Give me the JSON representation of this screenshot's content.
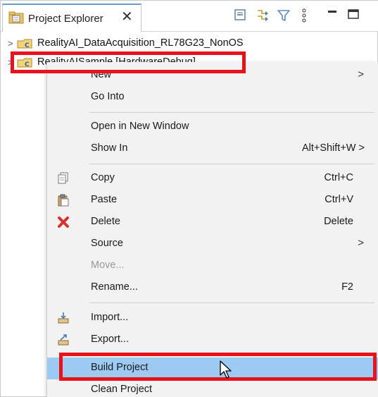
{
  "view": {
    "tab_title": "Project Explorer",
    "tab_close": "✕"
  },
  "tree": {
    "items": [
      {
        "arrow": ">",
        "label": "RealityAI_DataAcquisition_RL78G23_NonOS"
      },
      {
        "arrow": ">",
        "label": "RealityAISample [HardwareDebug]"
      }
    ]
  },
  "menu": {
    "items": [
      {
        "label": "New",
        "submenu": ">"
      },
      {
        "label": "Go Into"
      },
      {
        "label": "Open in New Window"
      },
      {
        "label": "Show In",
        "shortcut": "Alt+Shift+W >"
      },
      {
        "label": "Copy",
        "shortcut": "Ctrl+C",
        "icon": "copy-icon"
      },
      {
        "label": "Paste",
        "shortcut": "Ctrl+V",
        "icon": "paste-icon"
      },
      {
        "label": "Delete",
        "shortcut": "Delete",
        "icon": "delete-icon"
      },
      {
        "label": "Source",
        "submenu": ">"
      },
      {
        "label": "Move...",
        "disabled": true
      },
      {
        "label": "Rename...",
        "shortcut": "F2"
      },
      {
        "label": "Import...",
        "icon": "import-icon"
      },
      {
        "label": "Export...",
        "icon": "export-icon"
      },
      {
        "label": "Build Project",
        "highlighted": true
      },
      {
        "label": "Clean Project"
      }
    ]
  },
  "colors": {
    "highlight": "#9ccaf3",
    "annotation_red": "#e8121b",
    "menu_bg": "#f2f2f2"
  }
}
